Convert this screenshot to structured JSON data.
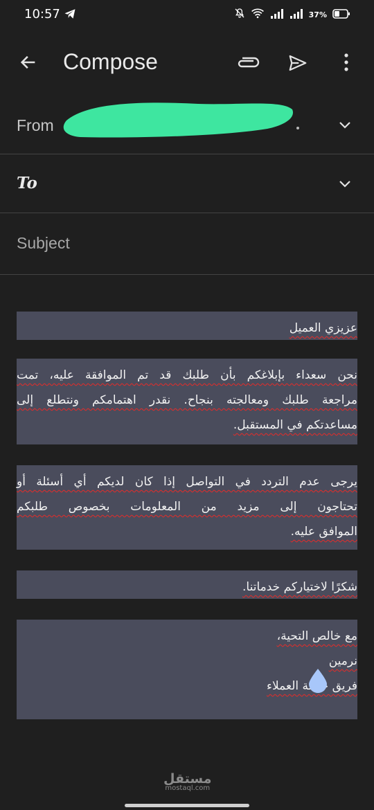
{
  "status_bar": {
    "time": "10:57",
    "battery": "37%",
    "icons": [
      "telegram-icon",
      "mute-icon",
      "wifi-icon",
      "signal-icon",
      "signal-icon",
      "battery-icon"
    ]
  },
  "app_bar": {
    "title": "Compose",
    "icons": [
      "back-arrow-icon",
      "attach-icon",
      "send-icon",
      "more-vert-icon"
    ]
  },
  "from": {
    "label": "From",
    "value_redacted": true
  },
  "to": {
    "label": "To"
  },
  "subject": {
    "placeholder": "Subject"
  },
  "body": {
    "greeting": "عزيزي العميل",
    "para1": [
      "نحن سعداء بإبلاغكم بأن طلبك قد تم الموافقة عليه، تمت",
      "مراجعة طلبك ومعالجته بنجاح. نقدر اهتمامكم ونتطلع إلى",
      "مساعدتكم في المستقبل."
    ],
    "para2": [
      "يرجى عدم التردد في التواصل إذا كان لديكم أي أسئلة أو",
      "تحتاجون إلى مزيد من المعلومات بخصوص طلبكم",
      "الموافق عليه."
    ],
    "thanks": "شكرًا لاختياركم خدماتنا.",
    "closing": [
      "مع خالص التحية،",
      "نرمين",
      "فريق خدمة العملاء"
    ]
  },
  "watermark": {
    "arabic": "مستقل",
    "latin": "mostaql.com"
  },
  "colors": {
    "background": "#1f1f1f",
    "paragraph_highlight": "#4a4c5c",
    "redaction": "#3ee6a0",
    "spellcheck": "#d32f2f"
  }
}
